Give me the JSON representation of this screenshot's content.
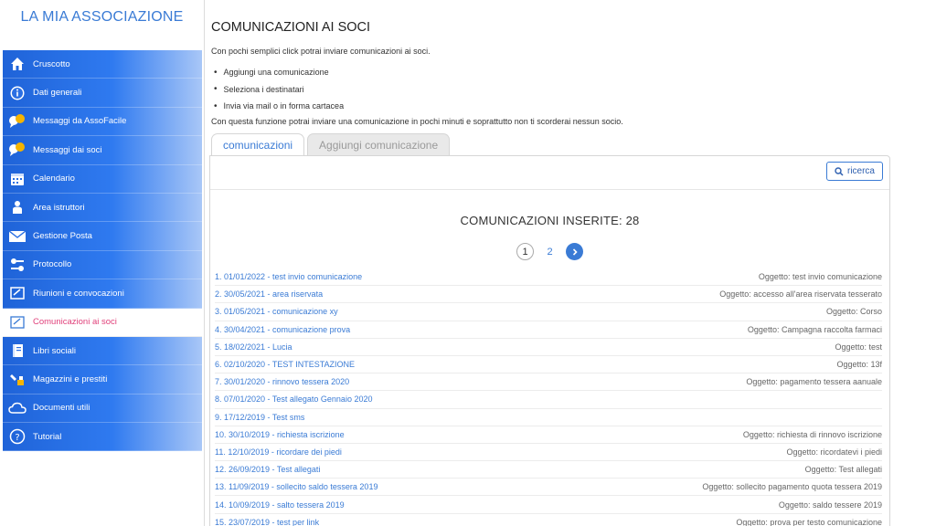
{
  "brand": "LA MIA ASSOCIAZIONE",
  "sidebar": {
    "items": [
      {
        "label": "Cruscotto",
        "icon": "home-icon"
      },
      {
        "label": "Dati generali",
        "icon": "info-icon"
      },
      {
        "label": "Messaggi da AssoFacile",
        "icon": "chat-icon"
      },
      {
        "label": "Messaggi dai soci",
        "icon": "chat-icon"
      },
      {
        "label": "Calendario",
        "icon": "calendar-icon"
      },
      {
        "label": "Area istruttori",
        "icon": "instructor-icon"
      },
      {
        "label": "Gestione Posta",
        "icon": "mail-icon"
      },
      {
        "label": "Protocollo",
        "icon": "protocol-icon"
      },
      {
        "label": "Riunioni e convocazioni",
        "icon": "meeting-icon"
      },
      {
        "label": "Comunicazioni ai soci",
        "icon": "communication-icon"
      },
      {
        "label": "Libri sociali",
        "icon": "book-icon"
      },
      {
        "label": "Magazzini e prestiti",
        "icon": "warehouse-icon"
      },
      {
        "label": "Documenti utili",
        "icon": "cloud-icon"
      },
      {
        "label": "Tutorial",
        "icon": "help-icon"
      }
    ]
  },
  "main": {
    "title": "COMUNICAZIONI AI SOCI",
    "intro": "Con pochi semplici click potrai inviare comunicazioni ai soci.",
    "bullets": [
      "Aggiungi una comunicazione",
      "Seleziona i destinatari",
      "Invia via mail o in forma cartacea"
    ],
    "description": "Con questa funzione potrai inviare una comunicazione in pochi minuti e soprattutto non ti scorderai nessun socio.",
    "tabs": [
      {
        "label": "comunicazioni"
      },
      {
        "label": "Aggiungi comunicazione"
      }
    ],
    "search_label": "ricerca",
    "count_title": "COMUNICAZIONI INSERITE: 28",
    "pagination": {
      "current": "1",
      "other": "2",
      "next": "›"
    },
    "rows": [
      {
        "title": "1. 01/01/2022 - test invio comunicazione",
        "subject": "Oggetto: test invio comunicazione"
      },
      {
        "title": "2. 30/05/2021 - area riservata",
        "subject": "Oggetto: accesso all'area riservata tesserato"
      },
      {
        "title": "3. 01/05/2021 - comunicazione xy",
        "subject": "Oggetto: Corso"
      },
      {
        "title": "4. 30/04/2021 - comunicazione prova",
        "subject": "Oggetto: Campagna raccolta farmaci"
      },
      {
        "title": "5. 18/02/2021 - Lucia",
        "subject": "Oggetto: test"
      },
      {
        "title": "6. 02/10/2020 - TEST INTESTAZIONE",
        "subject": "Oggetto: 13f"
      },
      {
        "title": "7. 30/01/2020 - rinnovo tessera 2020",
        "subject": "Oggetto: pagamento tessera aanuale"
      },
      {
        "title": "8. 07/01/2020 - Test allegato Gennaio 2020",
        "subject": ""
      },
      {
        "title": "9. 17/12/2019 - Test sms",
        "subject": ""
      },
      {
        "title": "10. 30/10/2019 - richiesta iscrizione",
        "subject": "Oggetto: richiesta di rinnovo iscrizione"
      },
      {
        "title": "11. 12/10/2019 - ricordare dei piedi",
        "subject": "Oggetto: ricordatevi i piedi"
      },
      {
        "title": "12. 26/09/2019 - Test allegati",
        "subject": "Oggetto: Test allegati"
      },
      {
        "title": "13. 11/09/2019 - sollecito saldo tessera 2019",
        "subject": "Oggetto: sollecito pagamento quota tessera 2019"
      },
      {
        "title": "14. 10/09/2019 - salto tessera 2019",
        "subject": "Oggetto: saldo tessere 2019"
      },
      {
        "title": "15. 23/07/2019 - test per link",
        "subject": "Oggetto: prova per testo comunicazione"
      }
    ]
  },
  "colors": {
    "accent": "#3a7bd5",
    "active_nav_text": "#e0407a",
    "nav_gradient_start": "#1f63d8"
  }
}
